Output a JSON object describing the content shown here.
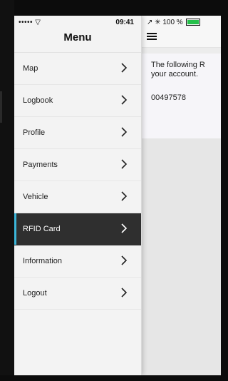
{
  "status": {
    "signal": "••••• ▽",
    "time": "09:41",
    "right": "↗ ✳ 100 %"
  },
  "menu": {
    "title": "Menu",
    "items": [
      {
        "label": "Map",
        "active": false
      },
      {
        "label": "Logbook",
        "active": false
      },
      {
        "label": "Profile",
        "active": false
      },
      {
        "label": "Payments",
        "active": false
      },
      {
        "label": "Vehicle",
        "active": false
      },
      {
        "label": "RFID Card",
        "active": true
      },
      {
        "label": "Information",
        "active": false
      },
      {
        "label": "Logout",
        "active": false
      }
    ],
    "icons": {
      "chevron": "chevron-right-icon",
      "hamburger": "hamburger-menu-icon"
    }
  },
  "main": {
    "note": "The following R… your account.",
    "note_line1": "The following R",
    "note_line2": "your account.",
    "card_number": "00497578"
  },
  "colors": {
    "active_bg": "#2f2f2f",
    "active_accent": "#3bb6d9",
    "battery": "#25c04a"
  }
}
